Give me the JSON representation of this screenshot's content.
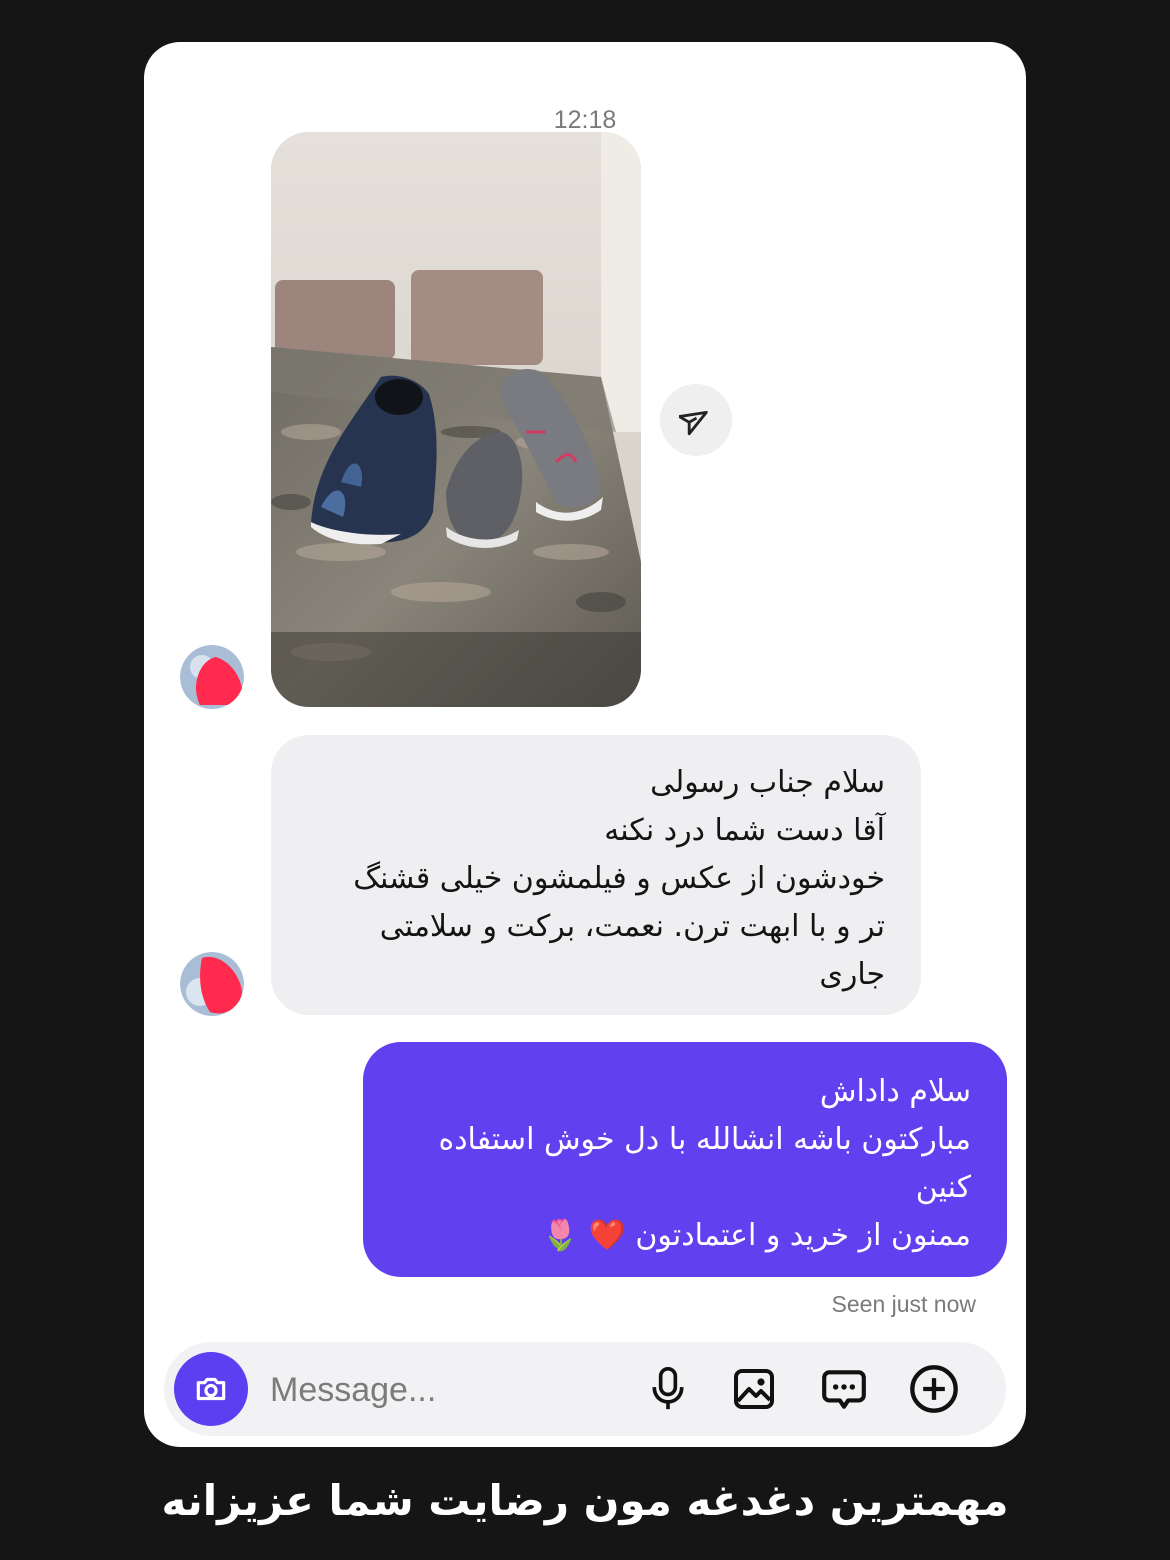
{
  "chat": {
    "timestamp": "12:18",
    "incoming_text": {
      "lines": [
        "سلام جناب رسولی",
        "آقا دست شما درد نکنه",
        "خودشون از عکس و فیلمشون خیلی قشنگ",
        "تر و با ابهت ترن. نعمت، برکت و سلامتی",
        "جاری"
      ]
    },
    "outgoing_text": {
      "lines": [
        "سلام داداش",
        "مبارکتون باشه انشالله با دل خوش استفاده",
        "کنین",
        "ممنون از خرید و اعتمادتون ❤️ 🌷"
      ]
    },
    "seen_status": "Seen just now"
  },
  "composer": {
    "placeholder": "Message..."
  },
  "caption": "مهمترین دغدغه مون رضایت شما عزیزانه",
  "icons": {
    "share": "paper-plane-icon",
    "camera": "camera-icon",
    "mic": "microphone-icon",
    "gallery": "image-icon",
    "sticker": "chat-bubble-icon",
    "add": "plus-circle-icon"
  },
  "colors": {
    "outgoing_bubble": "#6140f0",
    "incoming_bubble": "#efeff1",
    "camera_button": "#5b3ff0",
    "background": "#151515"
  }
}
